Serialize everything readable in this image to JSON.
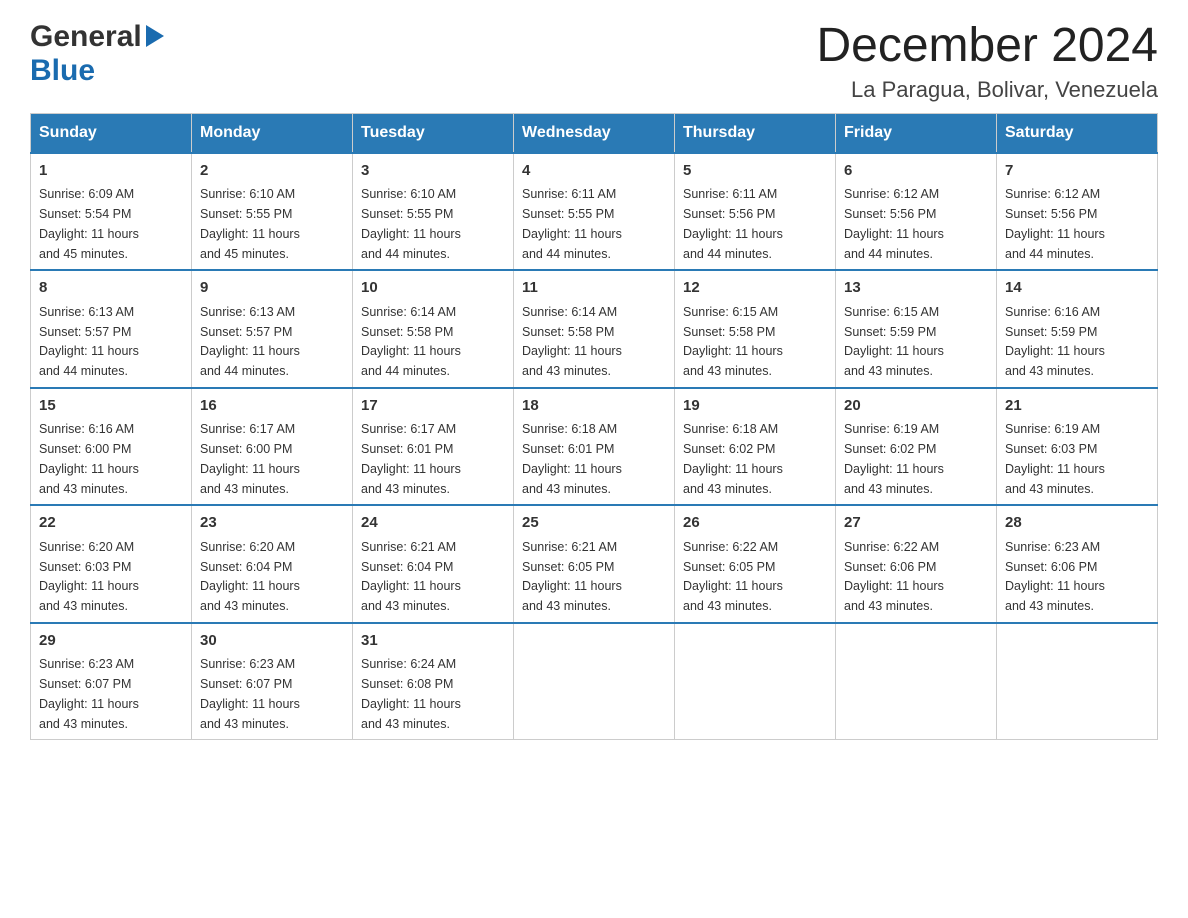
{
  "logo": {
    "general": "General",
    "blue": "Blue",
    "arrow": "▶"
  },
  "title": "December 2024",
  "subtitle": "La Paragua, Bolivar, Venezuela",
  "weekdays": [
    "Sunday",
    "Monday",
    "Tuesday",
    "Wednesday",
    "Thursday",
    "Friday",
    "Saturday"
  ],
  "weeks": [
    [
      {
        "day": "1",
        "info": "Sunrise: 6:09 AM\nSunset: 5:54 PM\nDaylight: 11 hours\nand 45 minutes."
      },
      {
        "day": "2",
        "info": "Sunrise: 6:10 AM\nSunset: 5:55 PM\nDaylight: 11 hours\nand 45 minutes."
      },
      {
        "day": "3",
        "info": "Sunrise: 6:10 AM\nSunset: 5:55 PM\nDaylight: 11 hours\nand 44 minutes."
      },
      {
        "day": "4",
        "info": "Sunrise: 6:11 AM\nSunset: 5:55 PM\nDaylight: 11 hours\nand 44 minutes."
      },
      {
        "day": "5",
        "info": "Sunrise: 6:11 AM\nSunset: 5:56 PM\nDaylight: 11 hours\nand 44 minutes."
      },
      {
        "day": "6",
        "info": "Sunrise: 6:12 AM\nSunset: 5:56 PM\nDaylight: 11 hours\nand 44 minutes."
      },
      {
        "day": "7",
        "info": "Sunrise: 6:12 AM\nSunset: 5:56 PM\nDaylight: 11 hours\nand 44 minutes."
      }
    ],
    [
      {
        "day": "8",
        "info": "Sunrise: 6:13 AM\nSunset: 5:57 PM\nDaylight: 11 hours\nand 44 minutes."
      },
      {
        "day": "9",
        "info": "Sunrise: 6:13 AM\nSunset: 5:57 PM\nDaylight: 11 hours\nand 44 minutes."
      },
      {
        "day": "10",
        "info": "Sunrise: 6:14 AM\nSunset: 5:58 PM\nDaylight: 11 hours\nand 44 minutes."
      },
      {
        "day": "11",
        "info": "Sunrise: 6:14 AM\nSunset: 5:58 PM\nDaylight: 11 hours\nand 43 minutes."
      },
      {
        "day": "12",
        "info": "Sunrise: 6:15 AM\nSunset: 5:58 PM\nDaylight: 11 hours\nand 43 minutes."
      },
      {
        "day": "13",
        "info": "Sunrise: 6:15 AM\nSunset: 5:59 PM\nDaylight: 11 hours\nand 43 minutes."
      },
      {
        "day": "14",
        "info": "Sunrise: 6:16 AM\nSunset: 5:59 PM\nDaylight: 11 hours\nand 43 minutes."
      }
    ],
    [
      {
        "day": "15",
        "info": "Sunrise: 6:16 AM\nSunset: 6:00 PM\nDaylight: 11 hours\nand 43 minutes."
      },
      {
        "day": "16",
        "info": "Sunrise: 6:17 AM\nSunset: 6:00 PM\nDaylight: 11 hours\nand 43 minutes."
      },
      {
        "day": "17",
        "info": "Sunrise: 6:17 AM\nSunset: 6:01 PM\nDaylight: 11 hours\nand 43 minutes."
      },
      {
        "day": "18",
        "info": "Sunrise: 6:18 AM\nSunset: 6:01 PM\nDaylight: 11 hours\nand 43 minutes."
      },
      {
        "day": "19",
        "info": "Sunrise: 6:18 AM\nSunset: 6:02 PM\nDaylight: 11 hours\nand 43 minutes."
      },
      {
        "day": "20",
        "info": "Sunrise: 6:19 AM\nSunset: 6:02 PM\nDaylight: 11 hours\nand 43 minutes."
      },
      {
        "day": "21",
        "info": "Sunrise: 6:19 AM\nSunset: 6:03 PM\nDaylight: 11 hours\nand 43 minutes."
      }
    ],
    [
      {
        "day": "22",
        "info": "Sunrise: 6:20 AM\nSunset: 6:03 PM\nDaylight: 11 hours\nand 43 minutes."
      },
      {
        "day": "23",
        "info": "Sunrise: 6:20 AM\nSunset: 6:04 PM\nDaylight: 11 hours\nand 43 minutes."
      },
      {
        "day": "24",
        "info": "Sunrise: 6:21 AM\nSunset: 6:04 PM\nDaylight: 11 hours\nand 43 minutes."
      },
      {
        "day": "25",
        "info": "Sunrise: 6:21 AM\nSunset: 6:05 PM\nDaylight: 11 hours\nand 43 minutes."
      },
      {
        "day": "26",
        "info": "Sunrise: 6:22 AM\nSunset: 6:05 PM\nDaylight: 11 hours\nand 43 minutes."
      },
      {
        "day": "27",
        "info": "Sunrise: 6:22 AM\nSunset: 6:06 PM\nDaylight: 11 hours\nand 43 minutes."
      },
      {
        "day": "28",
        "info": "Sunrise: 6:23 AM\nSunset: 6:06 PM\nDaylight: 11 hours\nand 43 minutes."
      }
    ],
    [
      {
        "day": "29",
        "info": "Sunrise: 6:23 AM\nSunset: 6:07 PM\nDaylight: 11 hours\nand 43 minutes."
      },
      {
        "day": "30",
        "info": "Sunrise: 6:23 AM\nSunset: 6:07 PM\nDaylight: 11 hours\nand 43 minutes."
      },
      {
        "day": "31",
        "info": "Sunrise: 6:24 AM\nSunset: 6:08 PM\nDaylight: 11 hours\nand 43 minutes."
      },
      null,
      null,
      null,
      null
    ]
  ]
}
